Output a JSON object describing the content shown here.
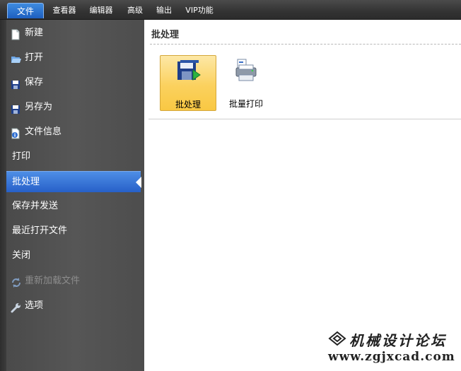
{
  "menubar": {
    "tabs": [
      {
        "label": "文件",
        "active": true
      },
      {
        "label": "查看器"
      },
      {
        "label": "编辑器"
      },
      {
        "label": "高级"
      },
      {
        "label": "输出"
      },
      {
        "label": "VIP功能"
      }
    ]
  },
  "sidebar": {
    "items": [
      {
        "label": "新建",
        "icon": "new-document-icon"
      },
      {
        "label": "打开",
        "icon": "open-folder-icon"
      },
      {
        "label": "保存",
        "icon": "save-disk-icon"
      },
      {
        "label": "另存为",
        "icon": "save-as-icon"
      },
      {
        "label": "文件信息",
        "icon": "file-info-icon"
      },
      {
        "label": "打印"
      },
      {
        "label": "批处理",
        "selected": true
      },
      {
        "label": "保存并发送"
      },
      {
        "label": "最近打开文件"
      },
      {
        "label": "关闭"
      },
      {
        "label": "重新加载文件",
        "icon": "reload-icon",
        "disabled": true
      },
      {
        "label": "选项",
        "icon": "wrench-icon"
      }
    ]
  },
  "content": {
    "title": "批处理",
    "buttons": [
      {
        "label": "批处理",
        "icon": "batch-process-icon",
        "selected": true
      },
      {
        "label": "批量打印",
        "icon": "batch-print-icon"
      }
    ]
  },
  "watermark": {
    "title": "机械设计论坛",
    "url": "www.zgjxcad.com"
  },
  "colors": {
    "menubar": "#333333",
    "active_tab": "#2a6fd0",
    "sidebar": "#515151",
    "selected_item": "#3a78d8",
    "selected_button": "#fbd15e"
  }
}
